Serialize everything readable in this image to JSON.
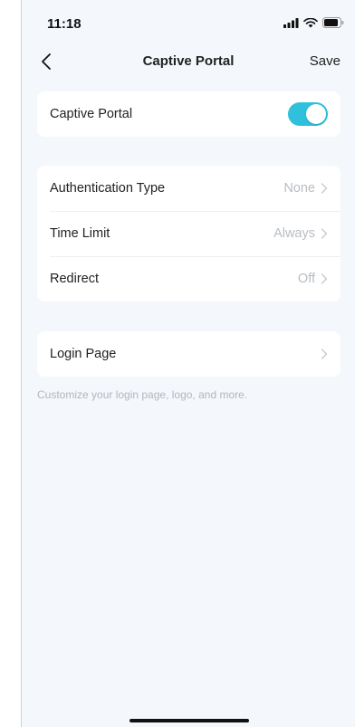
{
  "status_bar": {
    "time": "11:18",
    "icons": [
      "cellular-signal-icon",
      "wifi-icon",
      "battery-icon"
    ]
  },
  "nav": {
    "title": "Captive Portal",
    "back_icon": "chevron-left-icon",
    "save_label": "Save"
  },
  "captive_portal": {
    "label": "Captive Portal",
    "enabled": true,
    "toggle_color": "#2fc0dc"
  },
  "settings": {
    "authentication_type": {
      "label": "Authentication Type",
      "value": "None"
    },
    "time_limit": {
      "label": "Time Limit",
      "value": "Always"
    },
    "redirect": {
      "label": "Redirect",
      "value": "Off"
    }
  },
  "login_page": {
    "label": "Login Page",
    "hint": "Customize your login page, logo, and more."
  }
}
